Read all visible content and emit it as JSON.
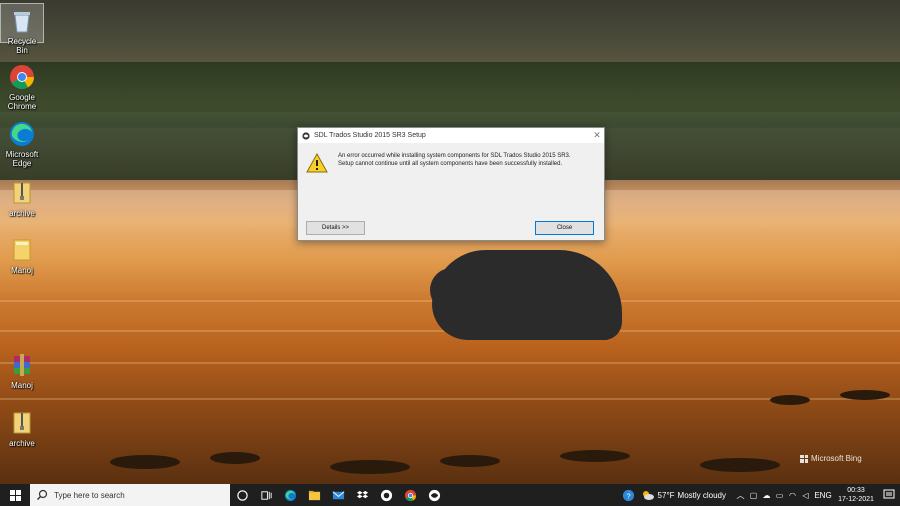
{
  "desktop_icons": [
    {
      "label": "Recycle Bin",
      "icon": "recycle-bin-icon"
    },
    {
      "label": "Google Chrome",
      "icon": "chrome-icon"
    },
    {
      "label": "Microsoft Edge",
      "icon": "edge-icon"
    },
    {
      "label": "archive",
      "icon": "zip-folder-icon"
    },
    {
      "label": "Manoj",
      "icon": "folder-icon"
    },
    {
      "label": "Manoj",
      "icon": "winrar-icon"
    },
    {
      "label": "archive",
      "icon": "zip-folder-icon"
    }
  ],
  "dialog": {
    "title": "SDL Trados Studio 2015 SR3 Setup",
    "message_line1": "An error occurred while installing system components for SDL Trados Studio 2015 SR3.",
    "message_line2": "Setup cannot continue until all system components have been successfully installed.",
    "details_label": "Details >>",
    "close_label": "Close"
  },
  "watermark": "Microsoft Bing",
  "taskbar": {
    "search_placeholder": "Type here to search",
    "weather_temp": "57°F",
    "weather_text": "Mostly cloudy",
    "language": "ENG",
    "time": "00:33",
    "date": "17-12-2021"
  },
  "colors": {
    "taskbar": "#1f1f1f",
    "dialog_bg": "#f0f0f0",
    "accent": "#0078d7"
  }
}
